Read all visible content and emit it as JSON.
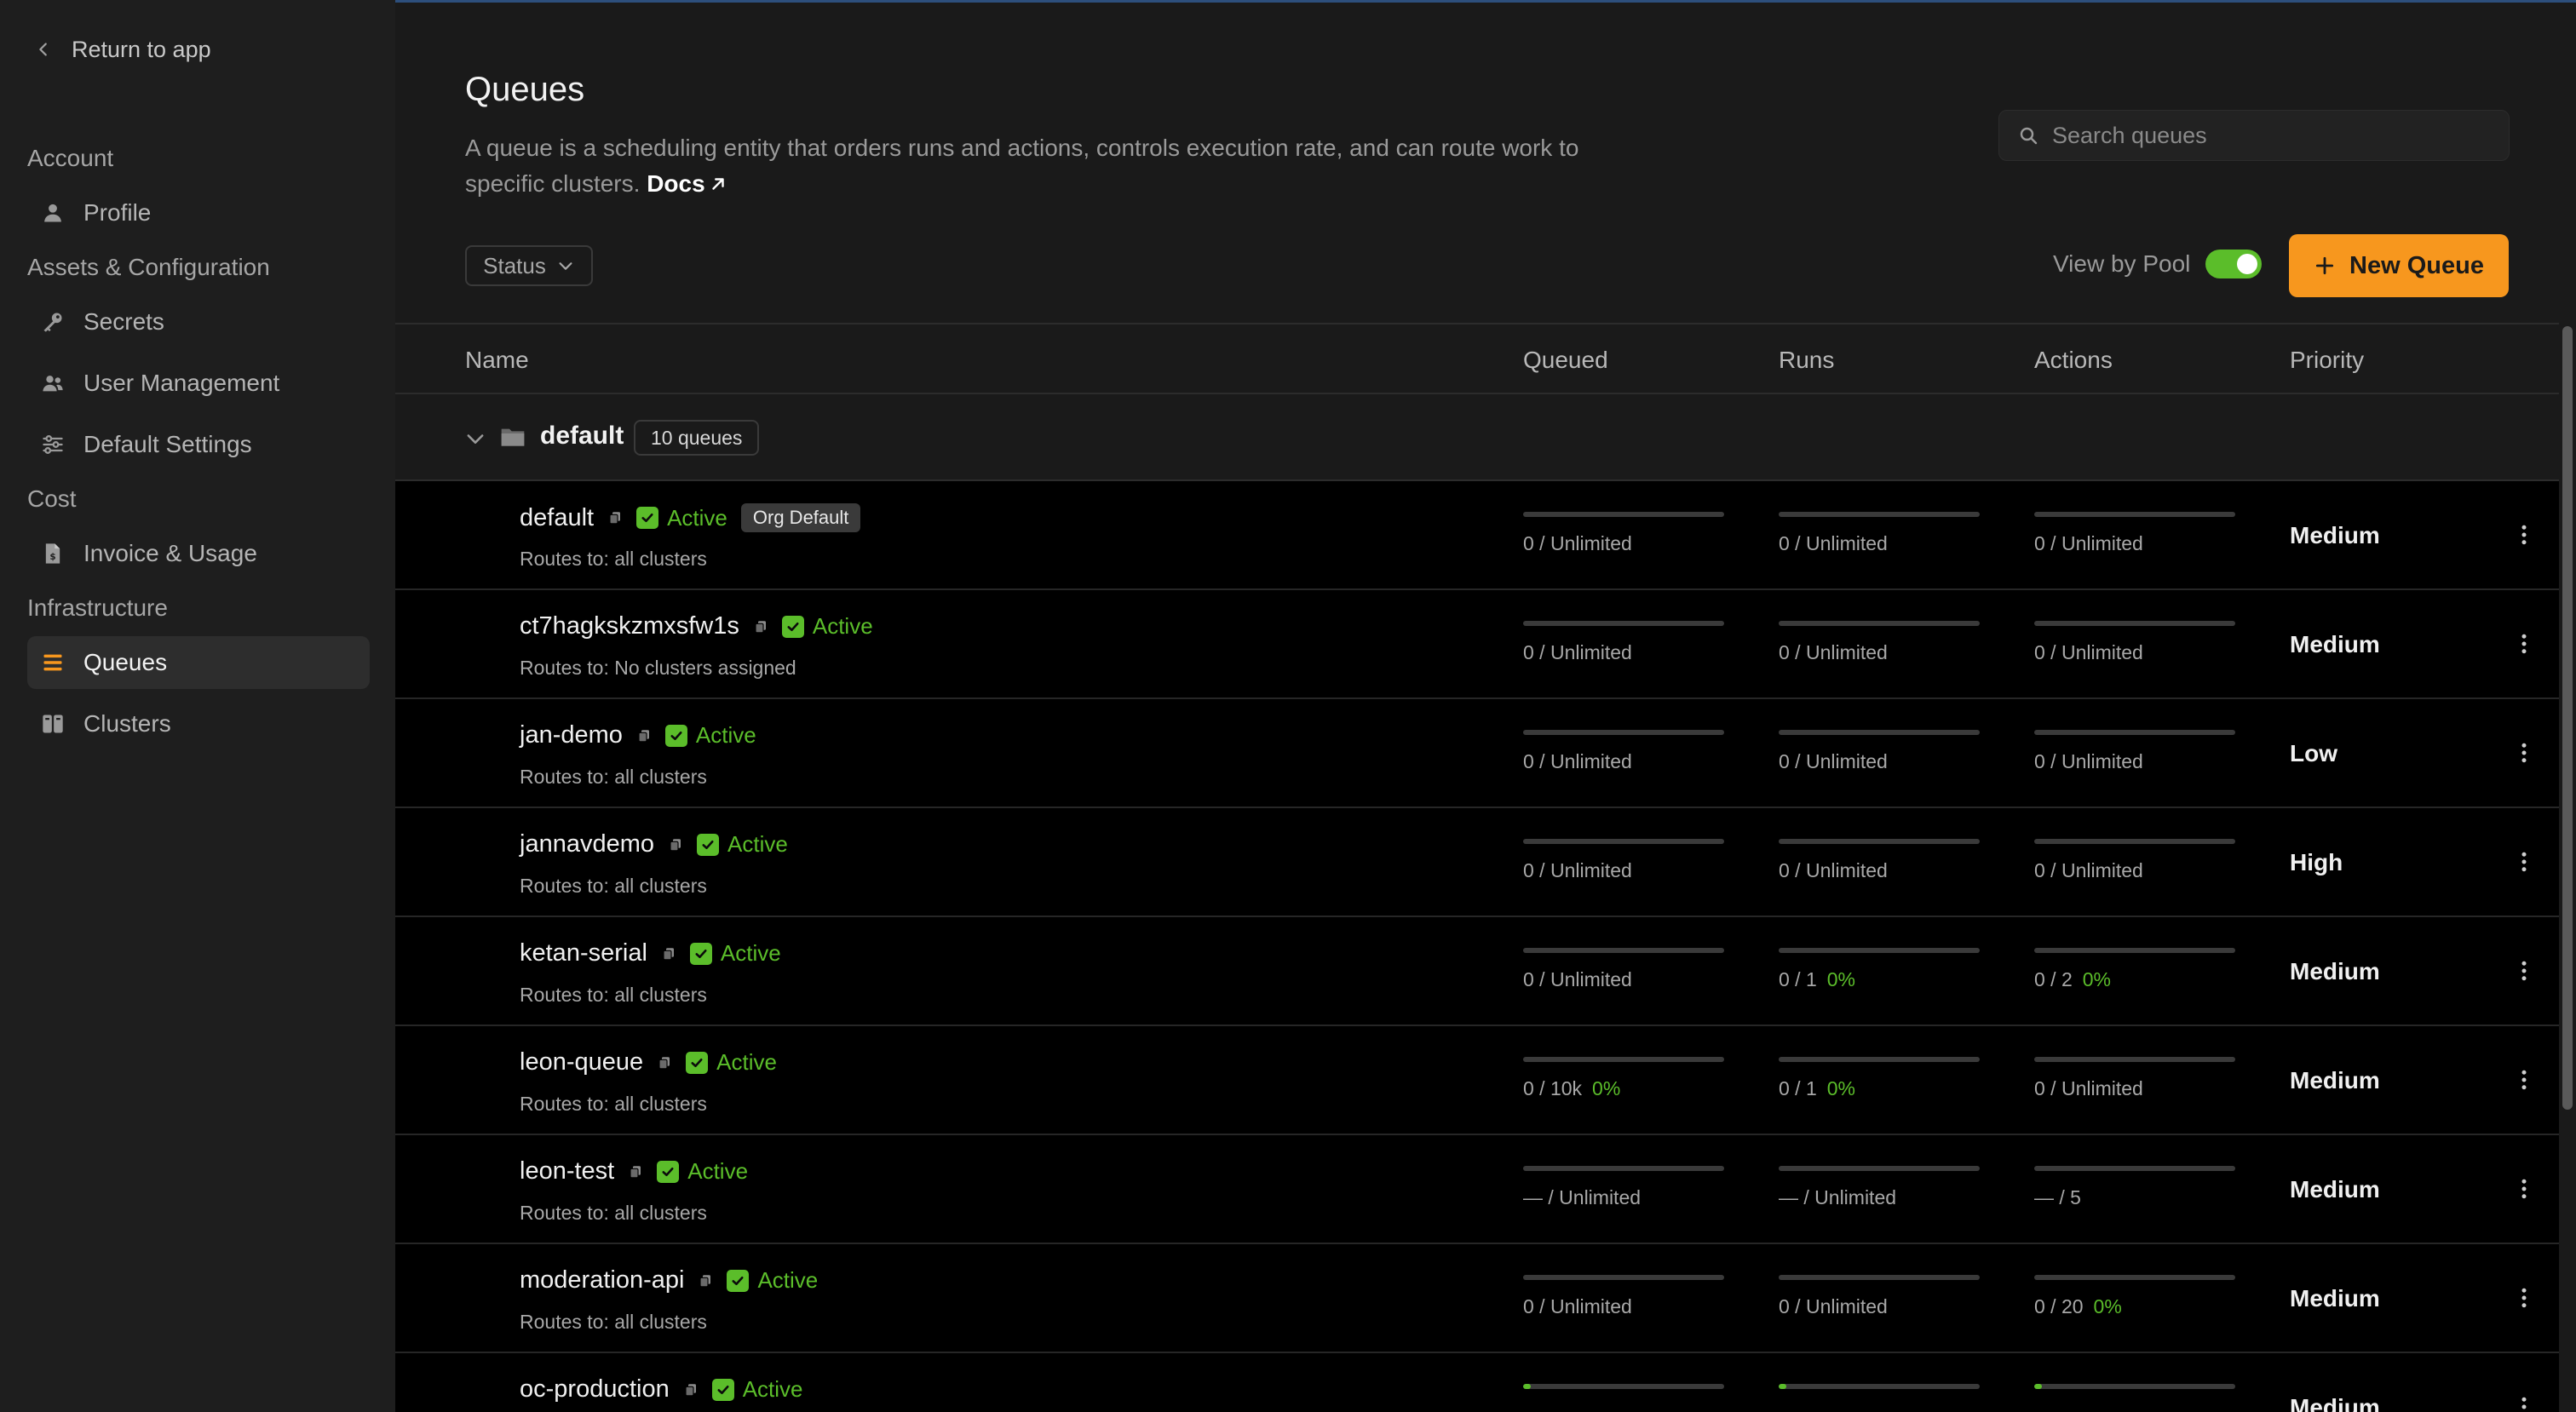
{
  "sidebar": {
    "return_label": "Return to app",
    "sections": {
      "account": "Account",
      "assets": "Assets & Configuration",
      "cost": "Cost",
      "infra": "Infrastructure"
    },
    "items": {
      "profile": "Profile",
      "secrets": "Secrets",
      "user_management": "User Management",
      "default_settings": "Default Settings",
      "invoice": "Invoice & Usage",
      "queues": "Queues",
      "clusters": "Clusters"
    }
  },
  "header": {
    "title": "Queues",
    "description": "A queue is a scheduling entity that orders runs and actions, controls execution rate, and can route work to specific clusters.",
    "docs_label": "Docs",
    "search_placeholder": "Search queues",
    "status_filter": "Status",
    "view_by_pool": "View by Pool",
    "new_queue": "New Queue"
  },
  "table": {
    "columns": {
      "name": "Name",
      "queued": "Queued",
      "runs": "Runs",
      "actions": "Actions",
      "priority": "Priority"
    },
    "group": {
      "name": "default",
      "count": "10 queues"
    },
    "rows": [
      {
        "name": "default",
        "status": "Active",
        "tag": "Org Default",
        "routes": "Routes to: all clusters",
        "queued": "0 / Unlimited",
        "queued_pct": "",
        "runs": "0 / Unlimited",
        "runs_pct": "",
        "actions": "0 / Unlimited",
        "actions_pct": "",
        "priority": "Medium"
      },
      {
        "name": "ct7hagkskzmxsfw1s",
        "status": "Active",
        "routes": "Routes to: No clusters assigned",
        "queued": "0 / Unlimited",
        "queued_pct": "",
        "runs": "0 / Unlimited",
        "runs_pct": "",
        "actions": "0 / Unlimited",
        "actions_pct": "",
        "priority": "Medium"
      },
      {
        "name": "jan-demo",
        "status": "Active",
        "routes": "Routes to: all clusters",
        "queued": "0 / Unlimited",
        "queued_pct": "",
        "runs": "0 / Unlimited",
        "runs_pct": "",
        "actions": "0 / Unlimited",
        "actions_pct": "",
        "priority": "Low"
      },
      {
        "name": "jannavdemo",
        "status": "Active",
        "routes": "Routes to: all clusters",
        "queued": "0 / Unlimited",
        "queued_pct": "",
        "runs": "0 / Unlimited",
        "runs_pct": "",
        "actions": "0 / Unlimited",
        "actions_pct": "",
        "priority": "High"
      },
      {
        "name": "ketan-serial",
        "status": "Active",
        "routes": "Routes to: all clusters",
        "queued": "0 / Unlimited",
        "queued_pct": "",
        "runs": "0 / 1",
        "runs_pct": "0%",
        "actions": "0 / 2",
        "actions_pct": "0%",
        "priority": "Medium"
      },
      {
        "name": "leon-queue",
        "status": "Active",
        "routes": "Routes to: all clusters",
        "queued": "0 / 10k",
        "queued_pct": "0%",
        "runs": "0 / 1",
        "runs_pct": "0%",
        "actions": "0 / Unlimited",
        "actions_pct": "",
        "priority": "Medium"
      },
      {
        "name": "leon-test",
        "status": "Active",
        "routes": "Routes to: all clusters",
        "queued": "— / Unlimited",
        "queued_pct": "",
        "runs": "— / Unlimited",
        "runs_pct": "",
        "actions": "— / 5",
        "actions_pct": "",
        "priority": "Medium"
      },
      {
        "name": "moderation-api",
        "status": "Active",
        "routes": "Routes to: all clusters",
        "queued": "0 / Unlimited",
        "queued_pct": "",
        "runs": "0 / Unlimited",
        "runs_pct": "",
        "actions": "0 / 20",
        "actions_pct": "0%",
        "priority": "Medium"
      },
      {
        "name": "oc-production",
        "status": "Active",
        "routes": "",
        "queued": "",
        "queued_pct": "",
        "runs": "",
        "runs_pct": "",
        "actions": "",
        "actions_pct": "",
        "priority": "Medium",
        "bar_fill": 0.04
      }
    ]
  },
  "colors": {
    "accent": "#f7971e",
    "active_green": "#5bbd2a",
    "sidebar_bg": "#1e1e1e",
    "main_bg": "#1a1a1a",
    "row_bg": "#000000"
  }
}
